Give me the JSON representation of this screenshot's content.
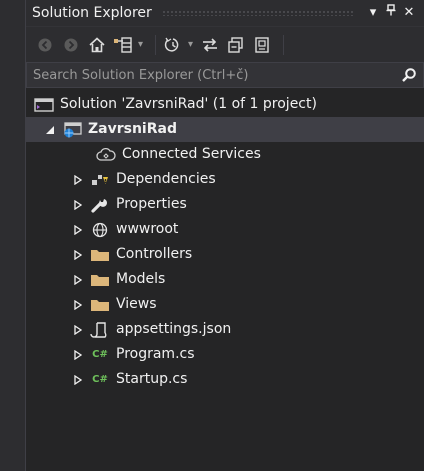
{
  "panel": {
    "title": "Solution Explorer",
    "pin_glyph": "⍑",
    "close_glyph": "✕",
    "menu_glyph": "▾"
  },
  "search": {
    "placeholder": "Search Solution Explorer (Ctrl+č)"
  },
  "toolbar": {
    "icons": [
      "back-icon",
      "forward-icon",
      "home-icon",
      "switch-views-icon",
      "pending-changes-icon",
      "sync-icon",
      "collapse-all-icon",
      "show-all-files-icon"
    ]
  },
  "tree": {
    "solution_label": "Solution 'ZavrsniRad' (1 of 1 project)",
    "project_label": "ZavrsniRad",
    "items": [
      {
        "label": "Connected Services",
        "icon": "connected-services-icon"
      },
      {
        "label": "Dependencies",
        "icon": "dependencies-icon"
      },
      {
        "label": "Properties",
        "icon": "wrench-icon"
      },
      {
        "label": "wwwroot",
        "icon": "globe-icon"
      },
      {
        "label": "Controllers",
        "icon": "folder-icon"
      },
      {
        "label": "Models",
        "icon": "folder-icon"
      },
      {
        "label": "Views",
        "icon": "folder-icon"
      },
      {
        "label": "appsettings.json",
        "icon": "json-file-icon"
      },
      {
        "label": "Program.cs",
        "icon": "csharp-file-icon"
      },
      {
        "label": "Startup.cs",
        "icon": "csharp-file-icon"
      }
    ],
    "csharp_glyph": "C#"
  },
  "colors": {
    "background": "#252526",
    "selected_row": "#3f3f46",
    "folder": "#dcb67a",
    "accent": "#68217a"
  }
}
